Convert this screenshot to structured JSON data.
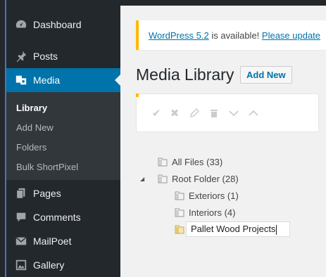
{
  "sidebar": {
    "items": [
      {
        "label": "Dashboard",
        "icon": "dashboard-icon"
      },
      {
        "label": "Posts",
        "icon": "pin-icon"
      },
      {
        "label": "Media",
        "icon": "media-icon"
      },
      {
        "label": "Pages",
        "icon": "pages-icon"
      },
      {
        "label": "Comments",
        "icon": "comments-icon"
      },
      {
        "label": "MailPoet",
        "icon": "mail-icon"
      },
      {
        "label": "Gallery",
        "icon": "gallery-icon"
      }
    ],
    "submenu": [
      "Library",
      "Add New",
      "Folders",
      "Bulk ShortPixel"
    ],
    "colors": {
      "bg": "#23282d",
      "active": "#0073aa",
      "submenu_bg": "#32373c"
    }
  },
  "notice": {
    "version_link": "WordPress 5.2",
    "text": " is available! ",
    "update_link": "Please update"
  },
  "header": {
    "title": "Media Library",
    "add_new": "Add New"
  },
  "toolbar": {
    "tools": [
      "check-icon",
      "close-icon",
      "pencil-icon",
      "trash-icon",
      "chevron-down-icon",
      "chevron-up-icon"
    ]
  },
  "tree": {
    "all_files": "All Files (33)",
    "root": "Root Folder (28)",
    "children": [
      "Exteriors (1)",
      "Interiors (4)"
    ],
    "new_folder_value": "Pallet Wood Projects"
  }
}
